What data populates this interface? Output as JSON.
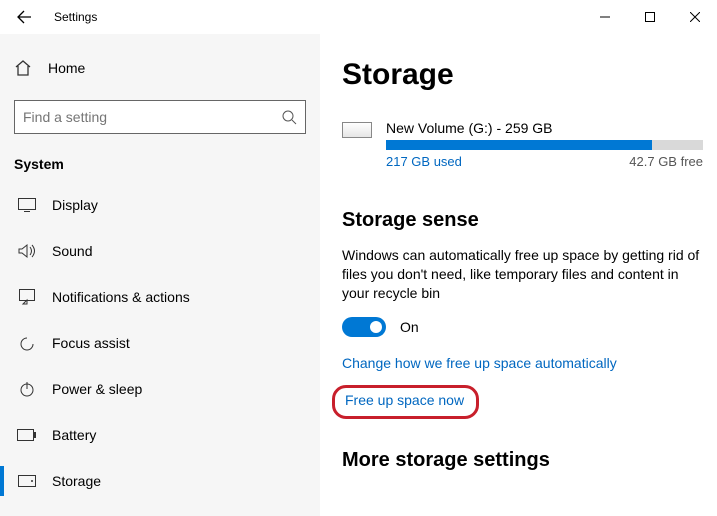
{
  "window": {
    "title": "Settings"
  },
  "sidebar": {
    "home_label": "Home",
    "search_placeholder": "Find a setting",
    "section_label": "System",
    "items": [
      {
        "label": "Display"
      },
      {
        "label": "Sound"
      },
      {
        "label": "Notifications & actions"
      },
      {
        "label": "Focus assist"
      },
      {
        "label": "Power & sleep"
      },
      {
        "label": "Battery"
      },
      {
        "label": "Storage"
      }
    ]
  },
  "main": {
    "title": "Storage",
    "volume": {
      "name": "New Volume (G:) - 259 GB",
      "used_label": "217 GB used",
      "free_label": "42.7 GB free",
      "used_pct": 84
    },
    "sense_heading": "Storage sense",
    "sense_desc": "Windows can automatically free up space by getting rid of files you don't need, like temporary files and content in your recycle bin",
    "sense_toggle_label": "On",
    "link_change": "Change how we free up space automatically",
    "link_free": "Free up space now",
    "more_heading": "More storage settings"
  }
}
